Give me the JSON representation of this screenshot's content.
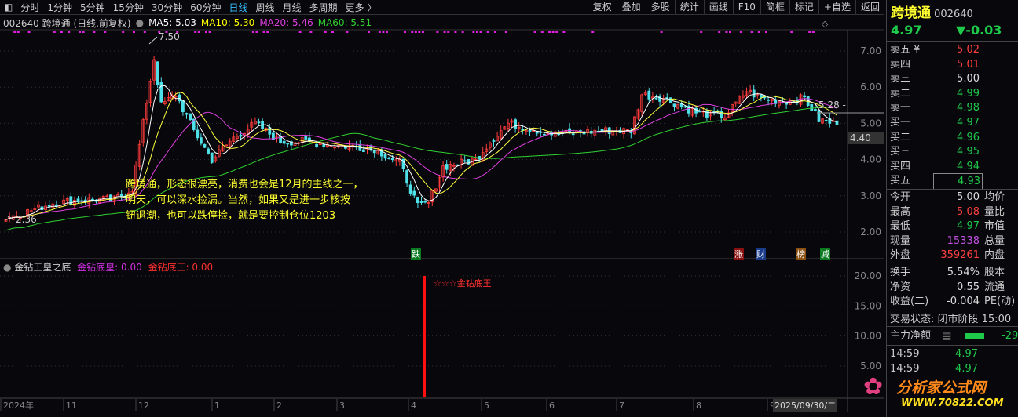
{
  "toolbar": {
    "tabs": [
      "分时",
      "1分钟",
      "5分钟",
      "15分钟",
      "30分钟",
      "60分钟",
      "日线",
      "周线",
      "月线",
      "多周期",
      "更多 〉"
    ],
    "active": "日线",
    "tools": [
      "复权",
      "叠加",
      "多股",
      "统计",
      "画线",
      "F10",
      "简框",
      "标记",
      "+自选",
      "返回"
    ]
  },
  "info": {
    "code_name": "002640 跨境通 (日线,前复权)",
    "ma5": "MA5: 5.03",
    "ma10": "MA10: 5.30",
    "ma20": "MA20: 5.46",
    "ma60": "MA60: 5.51"
  },
  "chart_data": {
    "type": "candlestick",
    "price_axis": [
      "7.00",
      "6.00",
      "5.00",
      "4.00",
      "3.00",
      "2.00"
    ],
    "cursor_price": "4.40",
    "high_label": "7.50",
    "low_label": "2.36",
    "line_label": "5.28 -",
    "x_ticks": [
      "2024年",
      "11",
      "12",
      "1",
      "2",
      "3",
      "4",
      "5",
      "6",
      "7",
      "8",
      "9"
    ],
    "cursor_date": "2025/09/30/二",
    "close_path": [
      [
        0,
        2.4
      ],
      [
        4,
        2.5
      ],
      [
        13,
        2.8
      ],
      [
        22,
        2.9
      ],
      [
        30,
        2.9
      ],
      [
        35,
        3.2
      ],
      [
        38,
        5.0
      ],
      [
        41,
        6.8
      ],
      [
        43,
        5.5
      ],
      [
        47,
        5.8
      ],
      [
        52,
        4.8
      ],
      [
        57,
        4.0
      ],
      [
        63,
        4.6
      ],
      [
        69,
        5.0
      ],
      [
        76,
        4.5
      ],
      [
        82,
        4.5
      ],
      [
        91,
        4.4
      ],
      [
        102,
        4.3
      ],
      [
        109,
        3.9
      ],
      [
        114,
        2.7
      ],
      [
        117,
        2.8
      ],
      [
        121,
        3.8
      ],
      [
        130,
        4.0
      ],
      [
        134,
        4.5
      ],
      [
        139,
        5.0
      ],
      [
        143,
        4.9
      ],
      [
        152,
        4.7
      ],
      [
        165,
        4.8
      ],
      [
        173,
        4.8
      ],
      [
        176,
        5.8
      ],
      [
        182,
        5.7
      ],
      [
        191,
        5.3
      ],
      [
        199,
        5.2
      ],
      [
        205,
        5.9
      ],
      [
        209,
        5.7
      ],
      [
        215,
        5.6
      ],
      [
        221,
        5.7
      ],
      [
        225,
        5.1
      ],
      [
        230,
        4.97
      ]
    ],
    "indicator": {
      "title": "金钻王皇之底",
      "s1": "金钻底皇: 0.00",
      "s2": "金钻底王: 0.00",
      "signal_label": "☆☆☆金钻底王",
      "axis": [
        "20.00",
        "15.00",
        "10.00",
        "5.00"
      ]
    }
  },
  "markers": [
    "跌",
    "涨",
    "财",
    "榜",
    "减"
  ],
  "annotation": [
    "跨境通，形态很漂亮，消费也会是12月的主线之一，",
    "明天，可以深水捡漏。当然，如果又是进一步核按",
    "钮退潮，也可以跌停捡，就是要控制仓位1203"
  ],
  "quote": {
    "name": "跨境通",
    "code": "002640",
    "price": "4.97",
    "change": "▼-0.03",
    "asks": [
      [
        "卖五 ¥",
        "5.02"
      ],
      [
        "卖四",
        "5.01"
      ],
      [
        "卖三",
        "5.00"
      ],
      [
        "卖二",
        "4.99"
      ],
      [
        "卖一",
        "4.98"
      ]
    ],
    "bids": [
      [
        "买一",
        "4.97"
      ],
      [
        "买二",
        "4.96"
      ],
      [
        "买三",
        "4.95"
      ],
      [
        "买四",
        "4.94"
      ],
      [
        "买五",
        "4.93"
      ]
    ],
    "stats": [
      [
        "今开",
        "5.00",
        "均价"
      ],
      [
        "最高",
        "5.08",
        "量比"
      ],
      [
        "最低",
        "4.97",
        "市值"
      ],
      [
        "现量",
        "15338",
        "总量"
      ],
      [
        "外盘",
        "359261",
        "内盘"
      ]
    ],
    "stats2": [
      [
        "换手",
        "5.54%",
        "股本"
      ],
      [
        "净资",
        "0.55",
        "流通"
      ],
      [
        "收益(二)",
        "-0.004",
        "PE(动)"
      ]
    ],
    "status": "交易状态: 闭市阶段 15:00",
    "main_flow": "主力净额",
    "main_flow_val": "-29",
    "ticks": [
      [
        "14:59",
        "4.97"
      ],
      [
        "14:59",
        "4.97"
      ]
    ]
  },
  "watermark": {
    "cn": "分析家公式网",
    "url": "WWW.70822.COM"
  },
  "colors": {
    "up": "#ff3b3b",
    "down": "#4fe0e8",
    "ma5": "#ffffff",
    "ma10": "#ffff40",
    "ma20": "#e040e0",
    "ma60": "#30d030"
  }
}
